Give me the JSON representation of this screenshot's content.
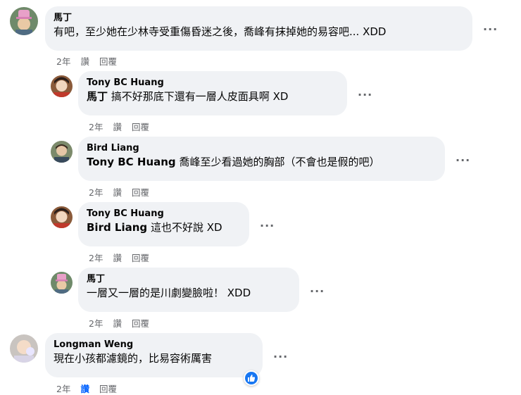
{
  "comments": [
    {
      "author": "馬丁",
      "mention": "",
      "text": "有吧，至少她在少林寺受重傷昏迷之後，喬峰有抹掉她的易容吧... XDD",
      "time": "2年",
      "like_label": "讚",
      "reply_label": "回覆",
      "more_label": "···",
      "avatar_icon": "hat-avatar-icon"
    },
    {
      "author": "Tony BC Huang",
      "mention": "馬丁",
      "text": "搞不好那底下還有一層人皮面具啊 XD",
      "time": "2年",
      "like_label": "讚",
      "reply_label": "回覆",
      "more_label": "···",
      "avatar_icon": "tony-avatar-icon"
    },
    {
      "author": "Bird Liang",
      "mention": "Tony BC Huang",
      "text": "喬峰至少看過她的胸部（不會也是假的吧）",
      "time": "2年",
      "like_label": "讚",
      "reply_label": "回覆",
      "more_label": "···",
      "avatar_icon": "bird-avatar-icon"
    },
    {
      "author": "Tony BC Huang",
      "mention": "Bird Liang",
      "text": "這也不好說 XD",
      "time": "2年",
      "like_label": "讚",
      "reply_label": "回覆",
      "more_label": "···",
      "avatar_icon": "tony-avatar-icon"
    },
    {
      "author": "馬丁",
      "mention": "",
      "text": "一層又一層的是川劇變臉啦！ XDD",
      "time": "2年",
      "like_label": "讚",
      "reply_label": "回覆",
      "more_label": "···",
      "avatar_icon": "hat-avatar-icon"
    },
    {
      "author": "Longman Weng",
      "mention": "",
      "text": "現在小孩都濾鏡的，比易容術厲害",
      "time": "2年",
      "like_label": "讚",
      "reply_label": "回覆",
      "more_label": "···",
      "avatar_icon": "baby-avatar-icon",
      "reaction_icon": "thumbs-up-icon",
      "liked": true
    }
  ],
  "colors": {
    "bubble": "#f0f2f5",
    "meta": "#65676b",
    "like_active": "#0866ff",
    "reaction_blue": "#1877f2"
  }
}
